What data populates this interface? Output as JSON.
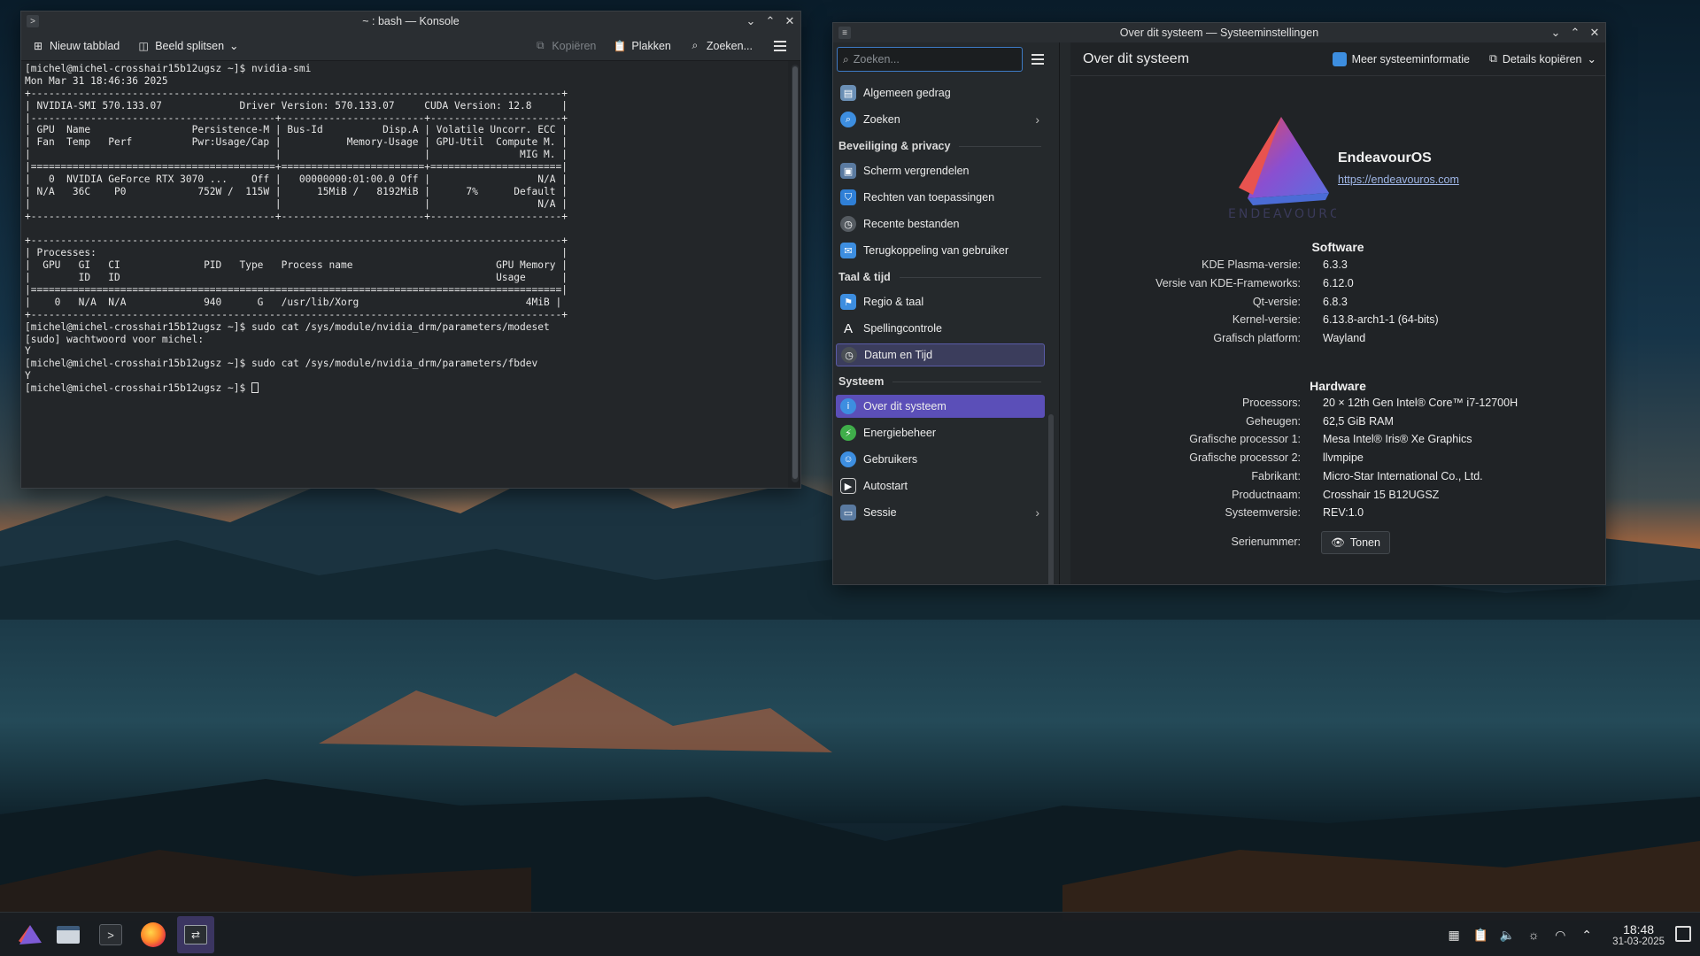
{
  "konsole": {
    "title": "~ : bash — Konsole",
    "toolbar": {
      "new_tab": "Nieuw tabblad",
      "split_view": "Beeld splitsen",
      "copy": "Kopiëren",
      "paste": "Plakken",
      "find": "Zoeken..."
    },
    "lines": [
      "[michel@michel-crosshair15b12ugsz ~]$ nvidia-smi",
      "Mon Mar 31 18:46:36 2025",
      "+-----------------------------------------------------------------------------------------+",
      "| NVIDIA-SMI 570.133.07             Driver Version: 570.133.07     CUDA Version: 12.8     |",
      "|-----------------------------------------+------------------------+----------------------+",
      "| GPU  Name                 Persistence-M | Bus-Id          Disp.A | Volatile Uncorr. ECC |",
      "| Fan  Temp   Perf          Pwr:Usage/Cap |           Memory-Usage | GPU-Util  Compute M. |",
      "|                                         |                        |               MIG M. |",
      "|=========================================+========================+======================|",
      "|   0  NVIDIA GeForce RTX 3070 ...    Off |   00000000:01:00.0 Off |                  N/A |",
      "| N/A   36C    P0            752W /  115W |      15MiB /   8192MiB |      7%      Default |",
      "|                                         |                        |                  N/A |",
      "+-----------------------------------------+------------------------+----------------------+",
      "",
      "+-----------------------------------------------------------------------------------------+",
      "| Processes:                                                                              |",
      "|  GPU   GI   CI              PID   Type   Process name                        GPU Memory |",
      "|        ID   ID                                                               Usage      |",
      "|=========================================================================================|",
      "|    0   N/A  N/A             940      G   /usr/lib/Xorg                            4MiB |",
      "+-----------------------------------------------------------------------------------------+",
      "[michel@michel-crosshair15b12ugsz ~]$ sudo cat /sys/module/nvidia_drm/parameters/modeset",
      "[sudo] wachtwoord voor michel:",
      "Y",
      "[michel@michel-crosshair15b12ugsz ~]$ sudo cat /sys/module/nvidia_drm/parameters/fbdev",
      "Y",
      "[michel@michel-crosshair15b12ugsz ~]$ "
    ]
  },
  "settings": {
    "title": "Over dit systeem — Systeeminstellingen",
    "search_placeholder": "Zoeken...",
    "page_title": "Over dit systeem",
    "more_info": "Meer systeeminformatie",
    "copy_details": "Details kopiëren",
    "sidebar": {
      "item_general": "Algemeen gedrag",
      "item_search": "Zoeken",
      "section_security": "Beveiliging & privacy",
      "item_lock": "Scherm vergrendelen",
      "item_app_perms": "Rechten van toepassingen",
      "item_recent": "Recente bestanden",
      "item_feedback": "Terugkoppeling van gebruiker",
      "section_lang": "Taal & tijd",
      "item_region": "Regio & taal",
      "item_spell": "Spellingcontrole",
      "item_datetime": "Datum en Tijd",
      "section_system": "Systeem",
      "item_about": "Over dit systeem",
      "item_power": "Energiebeheer",
      "item_users": "Gebruikers",
      "item_autostart": "Autostart",
      "item_session": "Sessie"
    },
    "distro": {
      "name": "EndeavourOS",
      "url": "https://endeavouros.com",
      "logo_text": "ENDEAVOUROS"
    },
    "software": {
      "title": "Software",
      "rows": [
        {
          "k": "KDE Plasma-versie:",
          "v": "6.3.3"
        },
        {
          "k": "Versie van KDE-Frameworks:",
          "v": "6.12.0"
        },
        {
          "k": "Qt-versie:",
          "v": "6.8.3"
        },
        {
          "k": "Kernel-versie:",
          "v": "6.13.8-arch1-1 (64-bits)"
        },
        {
          "k": "Grafisch platform:",
          "v": "Wayland"
        }
      ]
    },
    "hardware": {
      "title": "Hardware",
      "rows": [
        {
          "k": "Processors:",
          "v": "20 × 12th Gen Intel® Core™ i7-12700H"
        },
        {
          "k": "Geheugen:",
          "v": "62,5 GiB RAM"
        },
        {
          "k": "Grafische processor 1:",
          "v": "Mesa Intel® Iris® Xe Graphics"
        },
        {
          "k": "Grafische processor 2:",
          "v": "llvmpipe"
        },
        {
          "k": "Fabrikant:",
          "v": "Micro-Star International Co., Ltd."
        },
        {
          "k": "Productnaam:",
          "v": "Crosshair 15 B12UGSZ"
        },
        {
          "k": "Systeemversie:",
          "v": "REV:1.0"
        }
      ],
      "serial_label": "Serienummer:",
      "serial_button": "Tonen"
    }
  },
  "taskbar": {
    "time": "18:48",
    "date": "31-03-2025"
  },
  "colors": {
    "accent": "#5b4fb8",
    "window_bg": "#202326",
    "link": "#9fb6e6"
  }
}
